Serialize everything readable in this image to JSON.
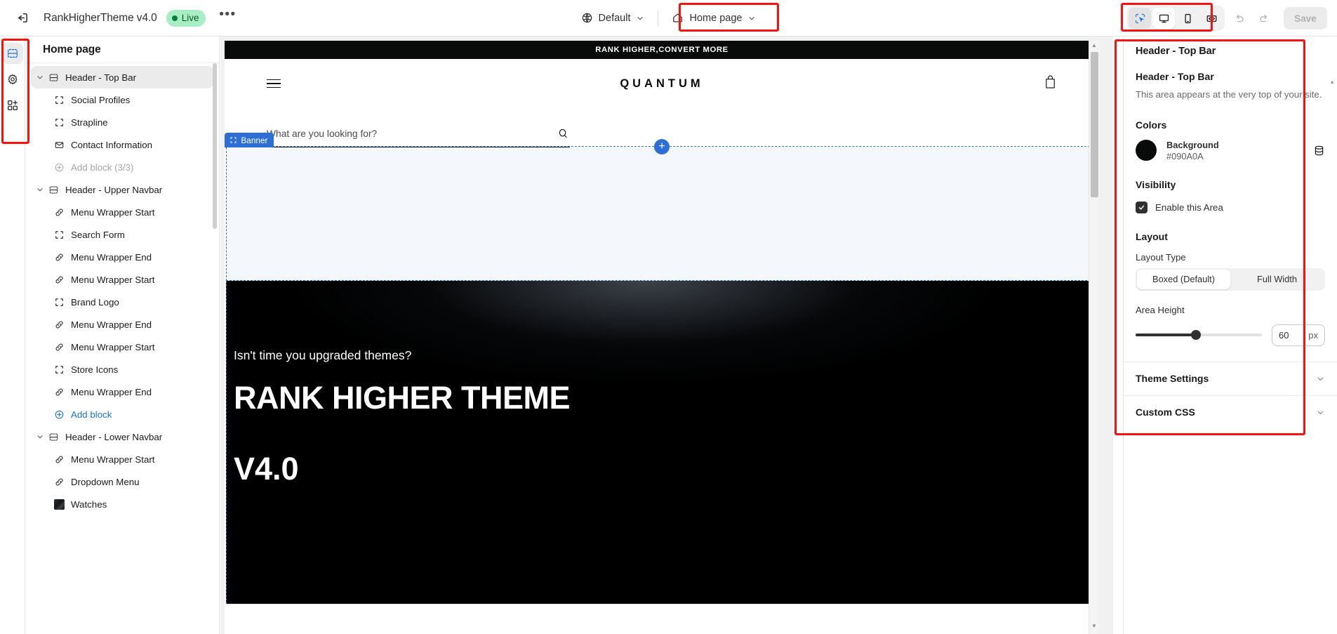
{
  "topbar": {
    "exit_icon": "exit-icon",
    "theme_name": "RankHigherTheme v4.0",
    "live_label": "Live",
    "more_label": "•••",
    "market_icon": "globe-icon",
    "market_label": "Default",
    "page_icon": "home-icon",
    "page_label": "Home page",
    "devices": [
      {
        "name": "select-tool",
        "icon": "cursor-select-icon",
        "state": "selected"
      },
      {
        "name": "desktop-view",
        "icon": "desktop-icon",
        "state": "active"
      },
      {
        "name": "mobile-view",
        "icon": "mobile-icon",
        "state": "default"
      },
      {
        "name": "fullwidth-view",
        "icon": "fullwidth-icon",
        "state": "default"
      }
    ],
    "undo_icon": "undo-icon",
    "redo_icon": "redo-icon",
    "save_label": "Save"
  },
  "rail": {
    "items": [
      {
        "name": "sections-tab",
        "icon": "sections-icon",
        "active": true
      },
      {
        "name": "theme-settings-tab",
        "icon": "gear-icon",
        "active": false
      },
      {
        "name": "apps-tab",
        "icon": "apps-add-icon",
        "active": false
      }
    ]
  },
  "sidebar": {
    "title": "Home page",
    "items": [
      {
        "label": "Header - Top Bar",
        "icon": "section-icon",
        "type": "section",
        "expanded": true,
        "selected": true
      },
      {
        "label": "Social Profiles",
        "icon": "block-icon",
        "type": "block"
      },
      {
        "label": "Strapline",
        "icon": "block-icon",
        "type": "block"
      },
      {
        "label": "Contact Information",
        "icon": "envelope-icon",
        "type": "block"
      },
      {
        "label": "Add block (3/3)",
        "icon": "plus-circle-icon",
        "type": "add-disabled"
      },
      {
        "label": "Header - Upper Navbar",
        "icon": "section-icon",
        "type": "section",
        "expanded": true
      },
      {
        "label": "Menu Wrapper Start",
        "icon": "link-icon",
        "type": "block"
      },
      {
        "label": "Search Form",
        "icon": "block-icon",
        "type": "block"
      },
      {
        "label": "Menu Wrapper End",
        "icon": "link-icon",
        "type": "block"
      },
      {
        "label": "Menu Wrapper Start",
        "icon": "link-icon",
        "type": "block"
      },
      {
        "label": "Brand Logo",
        "icon": "block-icon",
        "type": "block"
      },
      {
        "label": "Menu Wrapper End",
        "icon": "link-icon",
        "type": "block"
      },
      {
        "label": "Menu Wrapper Start",
        "icon": "link-icon",
        "type": "block"
      },
      {
        "label": "Store Icons",
        "icon": "block-icon",
        "type": "block"
      },
      {
        "label": "Menu Wrapper End",
        "icon": "link-icon",
        "type": "block"
      },
      {
        "label": "Add block",
        "icon": "plus-circle-icon",
        "type": "add"
      },
      {
        "label": "Header - Lower Navbar",
        "icon": "section-icon",
        "type": "section",
        "expanded": true
      },
      {
        "label": "Menu Wrapper Start",
        "icon": "link-icon",
        "type": "block"
      },
      {
        "label": "Dropdown Menu",
        "icon": "link-icon",
        "type": "block"
      },
      {
        "label": "Watches",
        "icon": "image-thumbnail",
        "type": "block"
      }
    ]
  },
  "canvas": {
    "announcement": "RANK HIGHER,CONVERT MORE",
    "brand": "QUANTUM",
    "menu_icon": "hamburger-icon",
    "cart_icon": "shopping-bag-icon",
    "search_placeholder": "What are you looking for?",
    "search_value": "",
    "search_icon": "search-icon",
    "selection_label": "Banner",
    "add_section_label": "+",
    "hero_kicker": "Isn't time you upgraded themes?",
    "hero_heading": "RANK HIGHER THEME",
    "hero_version": "V4.0"
  },
  "panel": {
    "breadcrumb": "Header - Top Bar",
    "heading": "Header - Top Bar",
    "description": "This area appears at the very top of your site.",
    "colors_heading": "Colors",
    "color_name": "Background",
    "color_value": "#090A0A",
    "color_picker_icon": "color-library-icon",
    "visibility_heading": "Visibility",
    "enable_label": "Enable this Area",
    "enable_checked": true,
    "layout_heading": "Layout",
    "layout_type_label": "Layout Type",
    "layout_options": [
      "Boxed (Default)",
      "Full Width"
    ],
    "layout_selected": "Boxed (Default)",
    "area_height_label": "Area Height",
    "area_height_value": "60",
    "area_height_unit": "px",
    "accordions": [
      "Theme Settings",
      "Custom CSS"
    ]
  }
}
